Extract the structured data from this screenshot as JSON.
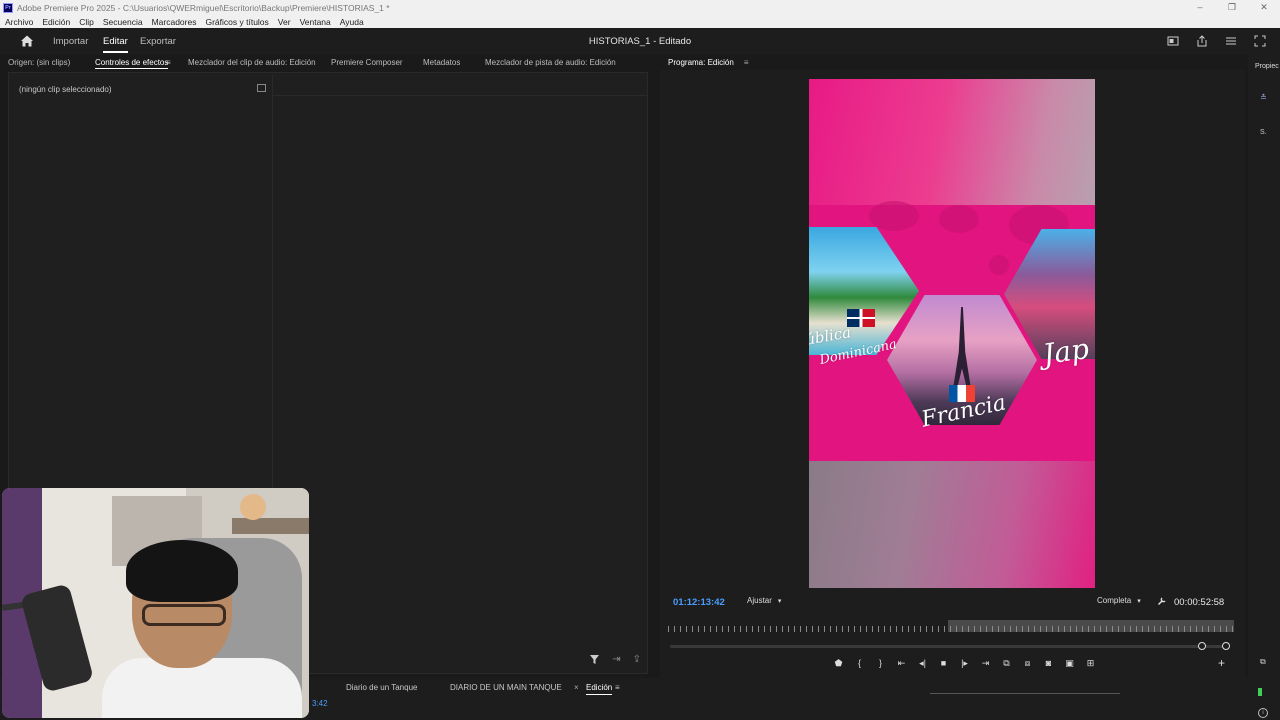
{
  "window": {
    "title": "Adobe Premiere Pro 2025 - C:\\Usuarios\\QWERmiguel\\Escritorio\\Backup\\Premiere\\HISTORIAS_1 *",
    "app_icon_text": "Pr",
    "controls": [
      "–",
      "❐",
      "✕"
    ]
  },
  "menu": [
    "Archivo",
    "Edición",
    "Clip",
    "Secuencia",
    "Marcadores",
    "Gráficos y títulos",
    "Ver",
    "Ventana",
    "Ayuda"
  ],
  "header": {
    "tabs": [
      "Importar",
      "Editar",
      "Exportar"
    ],
    "active_tab": "Editar",
    "doc_title": "HISTORIAS_1 - Editado"
  },
  "panel_tabs": {
    "source": "Origen: (sin clips)",
    "effect_controls": "Controles de efectos",
    "audio_clip_mixer": "Mezclador del clip de audio: Edición",
    "composer": "Premiere Composer",
    "metadata": "Metadatos",
    "track_mixer": "Mezclador de pista de audio: Edición"
  },
  "effect_controls": {
    "empty_label": "(ningún clip seleccionado)"
  },
  "program": {
    "tab_label": "Programa: Edición",
    "timecode_current": "01:12:13:42",
    "fit_label": "Ajustar",
    "quality_label": "Completa",
    "timecode_duration": "00:00:52:58",
    "video_texts": {
      "republica_1": "ública",
      "republica_2": "Dominicana",
      "francia": "Francia",
      "japon": "Jap"
    }
  },
  "right_panel": {
    "label": "Propiec",
    "secondary": "S."
  },
  "timeline": {
    "tabs": [
      "Diario de un Tanque",
      "DIARIO DE UN MAIN TANQUE",
      "Edición"
    ],
    "active_tab": "Edición",
    "partial_timecode": "3:42"
  },
  "icons": {
    "home": "home-icon",
    "menu": "hamburger-icon",
    "wrench": "wrench-icon",
    "filter": "filter-icon"
  },
  "colors": {
    "timecode_blue": "#4a9eff",
    "video_pink": "#e2147f",
    "meter_green": "#3fcf5a"
  }
}
